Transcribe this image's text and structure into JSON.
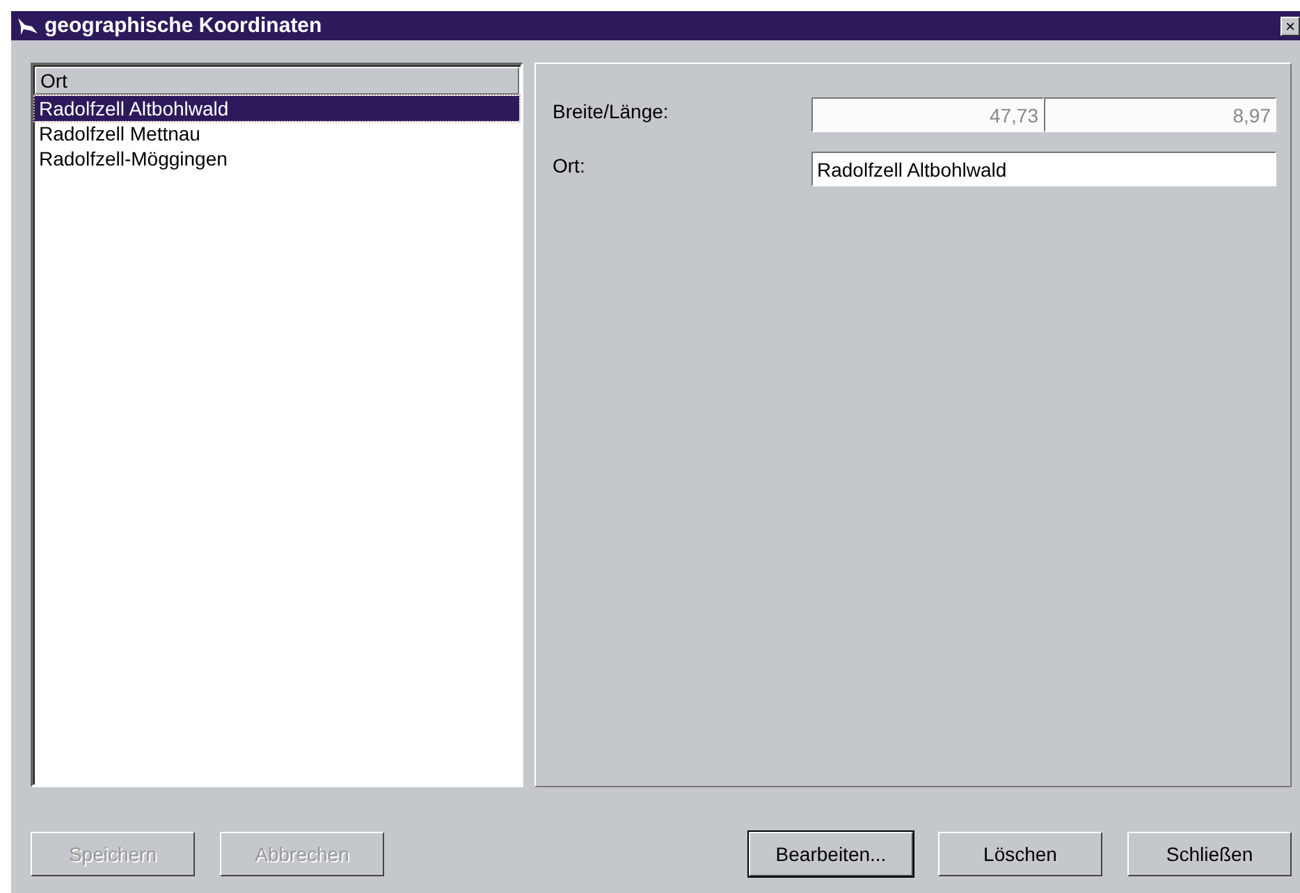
{
  "window": {
    "title": "geographische Koordinaten",
    "close": "×"
  },
  "list": {
    "header": "Ort",
    "items": [
      {
        "label": "Radolfzell Altbohlwald",
        "selected": true
      },
      {
        "label": "Radolfzell Mettnau",
        "selected": false
      },
      {
        "label": "Radolfzell-Möggingen",
        "selected": false
      }
    ]
  },
  "form": {
    "coords_label": "Breite/Länge:",
    "latitude": "47,73",
    "longitude": "8,97",
    "coords_disabled": true,
    "place_label": "Ort:",
    "place": "Radolfzell Altbohlwald"
  },
  "buttons": [
    {
      "label": "Speichern",
      "disabled": true,
      "default": false
    },
    {
      "label": "Abbrechen",
      "disabled": true,
      "default": false
    },
    {
      "label": "Bearbeiten...",
      "disabled": false,
      "default": true
    },
    {
      "label": "Löschen",
      "disabled": false,
      "default": false
    },
    {
      "label": "Schließen",
      "disabled": false,
      "default": false
    }
  ]
}
